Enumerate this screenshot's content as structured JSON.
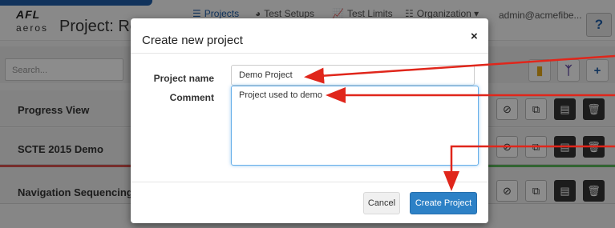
{
  "header": {
    "logo_afl": "AFL",
    "logo_aeros": "aeros",
    "project_title": "Project: Rea",
    "nav": [
      {
        "label": "Projects",
        "icon": "list-icon",
        "active": true
      },
      {
        "label": "Test Setups",
        "icon": "pie-icon",
        "active": false
      },
      {
        "label": "Test Limits",
        "icon": "chart-icon",
        "active": false
      },
      {
        "label": "Organization ▾",
        "icon": "sitemap-icon",
        "active": false
      }
    ],
    "user": "admin@acmefibe...",
    "help_label": "?"
  },
  "search": {
    "placeholder": "Search..."
  },
  "toolbar": {
    "icons": [
      "signal-icon",
      "fork-icon",
      "plus-icon"
    ]
  },
  "projects": [
    {
      "name": "Progress View"
    },
    {
      "name": "SCTE 2015 Demo"
    },
    {
      "name": "Navigation Sequencing"
    }
  ],
  "row_action_icons": [
    "ban-icon",
    "copy-icon",
    "archive-icon",
    "trash-icon"
  ],
  "modal": {
    "title": "Create new project",
    "close": "×",
    "project_name_label": "Project name",
    "project_name_value": "Demo Project",
    "comment_label": "Comment",
    "comment_value": "Project used to demo",
    "cancel_label": "Cancel",
    "create_label": "Create Project"
  },
  "colors": {
    "accent": "#2d81c6",
    "brand_blue": "#1f5ea8",
    "annotation_red": "#e0261b",
    "status_red": "#d9534f",
    "status_green": "#5cb85c"
  }
}
